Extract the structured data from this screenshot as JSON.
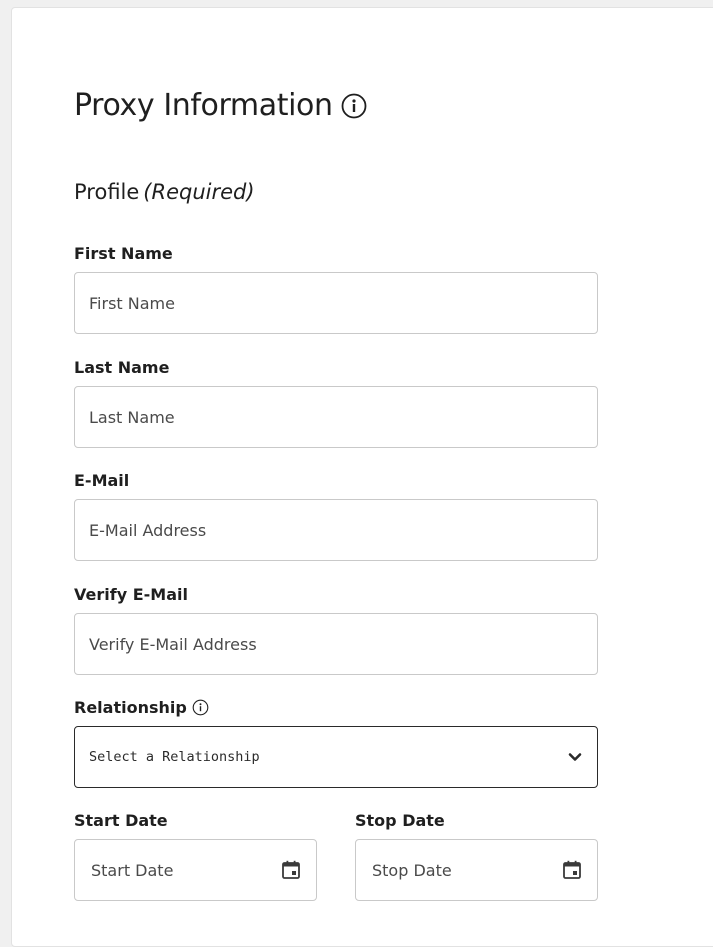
{
  "page": {
    "title": "Proxy Information",
    "section_title": "Profile",
    "section_required": "(Required)"
  },
  "fields": {
    "first_name": {
      "label": "First Name",
      "placeholder": "First Name",
      "value": ""
    },
    "last_name": {
      "label": "Last Name",
      "placeholder": "Last Name",
      "value": ""
    },
    "email": {
      "label": "E-Mail",
      "placeholder": "E-Mail Address",
      "value": ""
    },
    "verify_email": {
      "label": "Verify E-Mail",
      "placeholder": "Verify E-Mail Address",
      "value": ""
    },
    "relationship": {
      "label": "Relationship",
      "selected": "Select a Relationship"
    },
    "start_date": {
      "label": "Start Date",
      "placeholder": "Start Date",
      "value": ""
    },
    "stop_date": {
      "label": "Stop Date",
      "placeholder": "Stop Date",
      "value": ""
    }
  },
  "icons": {
    "title_info": "info-circle-icon",
    "relationship_info": "info-circle-icon",
    "relationship_dropdown": "chevron-down-icon",
    "start_date_picker": "calendar-icon",
    "stop_date_picker": "calendar-icon"
  },
  "colors": {
    "text": "#1f1f1f",
    "input_border": "#c9c9c9",
    "select_border": "#2a2a2a",
    "background": "#ffffff"
  }
}
